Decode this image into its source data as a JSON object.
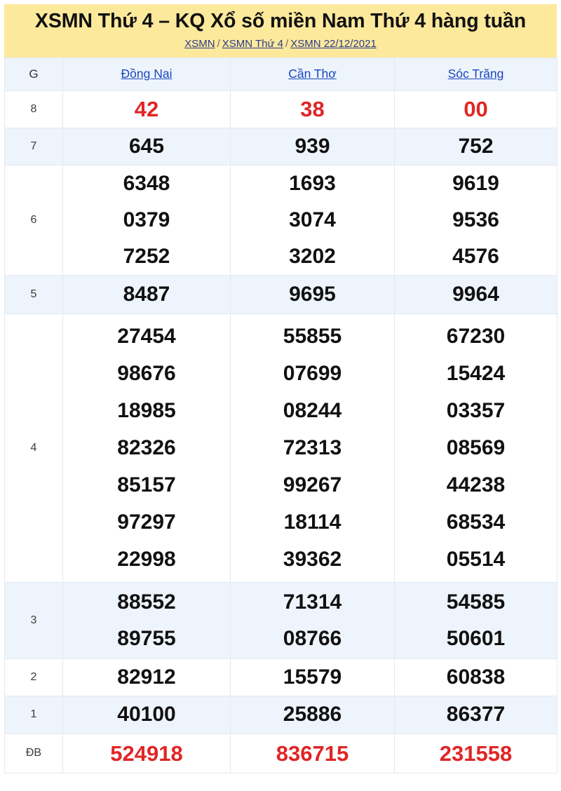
{
  "header": {
    "title": "XSMN Thứ 4 – KQ Xổ số miền Nam Thứ 4 hàng tuần",
    "background_color": "#fce99b",
    "breadcrumb": {
      "items": [
        "XSMN",
        "XSMN Thứ 4",
        "XSMN 22/12/2021"
      ],
      "separator": "/",
      "link_color": "#2b3a8f"
    }
  },
  "table": {
    "prize_column_header": "G",
    "provinces": [
      "Đồng Nai",
      "Cần Thơ",
      "Sóc Trăng"
    ],
    "province_link_color": "#1a45c0",
    "highlight_color": "#e02626",
    "row_tint_color": "#eef4fb",
    "rows": [
      {
        "label": "8",
        "highlight": true,
        "tinted": false,
        "values": [
          [
            "42"
          ],
          [
            "38"
          ],
          [
            "00"
          ]
        ]
      },
      {
        "label": "7",
        "highlight": false,
        "tinted": true,
        "values": [
          [
            "645"
          ],
          [
            "939"
          ],
          [
            "752"
          ]
        ]
      },
      {
        "label": "6",
        "highlight": false,
        "tinted": false,
        "values": [
          [
            "6348",
            "0379",
            "7252"
          ],
          [
            "1693",
            "3074",
            "3202"
          ],
          [
            "9619",
            "9536",
            "4576"
          ]
        ]
      },
      {
        "label": "5",
        "highlight": false,
        "tinted": true,
        "values": [
          [
            "8487"
          ],
          [
            "9695"
          ],
          [
            "9964"
          ]
        ]
      },
      {
        "label": "4",
        "highlight": false,
        "tinted": false,
        "values": [
          [
            "27454",
            "98676",
            "18985",
            "82326",
            "85157",
            "97297",
            "22998"
          ],
          [
            "55855",
            "07699",
            "08244",
            "72313",
            "99267",
            "18114",
            "39362"
          ],
          [
            "67230",
            "15424",
            "03357",
            "08569",
            "44238",
            "68534",
            "05514"
          ]
        ]
      },
      {
        "label": "3",
        "highlight": false,
        "tinted": true,
        "values": [
          [
            "88552",
            "89755"
          ],
          [
            "71314",
            "08766"
          ],
          [
            "54585",
            "50601"
          ]
        ]
      },
      {
        "label": "2",
        "highlight": false,
        "tinted": false,
        "values": [
          [
            "82912"
          ],
          [
            "15579"
          ],
          [
            "60838"
          ]
        ]
      },
      {
        "label": "1",
        "highlight": false,
        "tinted": true,
        "values": [
          [
            "40100"
          ],
          [
            "25886"
          ],
          [
            "86377"
          ]
        ]
      },
      {
        "label": "ĐB",
        "highlight": true,
        "tinted": false,
        "values": [
          [
            "524918"
          ],
          [
            "836715"
          ],
          [
            "231558"
          ]
        ]
      }
    ]
  }
}
